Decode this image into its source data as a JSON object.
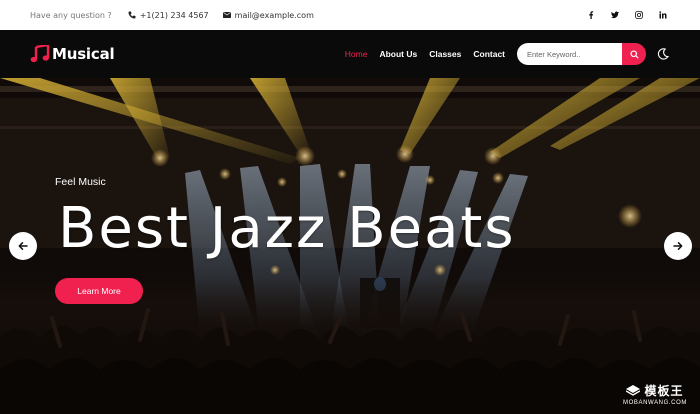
{
  "topbar": {
    "question": "Have any question ?",
    "phone": "+1(21) 234 4567",
    "email": "mail@example.com",
    "socials": [
      "facebook-icon",
      "twitter-icon",
      "instagram-icon",
      "linkedin-icon"
    ]
  },
  "nav": {
    "logo_text": "Musical",
    "links": [
      {
        "label": "Home",
        "active": true
      },
      {
        "label": "About Us",
        "active": false
      },
      {
        "label": "Classes",
        "active": false
      },
      {
        "label": "Contact",
        "active": false
      }
    ],
    "search_placeholder": "Enter Keyword..",
    "search_icon": "search-icon",
    "theme_icon": "moon-icon"
  },
  "hero": {
    "eyebrow": "Feel Music",
    "headline": "Best Jazz Beats",
    "cta_label": "Learn More",
    "prev_icon": "arrow-left-icon",
    "next_icon": "arrow-right-icon"
  },
  "watermark": {
    "cn": "模板王",
    "en": "MOBANWANG.COM"
  },
  "colors": {
    "accent": "#f0204f",
    "nav_bg": "#0a0a0a",
    "topbar_bg": "#ffffff"
  }
}
